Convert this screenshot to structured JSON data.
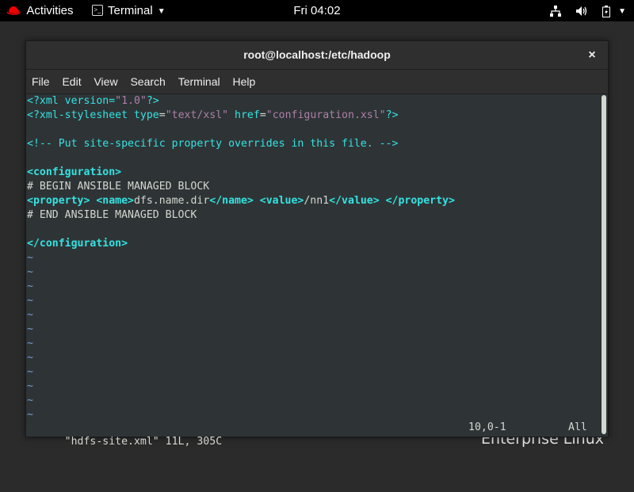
{
  "topbar": {
    "activities": "Activities",
    "app_menu": "Terminal",
    "clock": "Fri 04:02"
  },
  "window": {
    "title": "root@localhost:/etc/hadoop",
    "close": "×",
    "menu": [
      "File",
      "Edit",
      "View",
      "Search",
      "Terminal",
      "Help"
    ]
  },
  "editor": {
    "l1a": "<?xml version=",
    "l1b": "\"1.0\"",
    "l1c": "?>",
    "l2a": "<?xml-stylesheet ",
    "l2b": "type",
    "l2c": "=",
    "l2d": "\"text/xsl\"",
    "l2e": " href",
    "l2f": "=",
    "l2g": "\"configuration.xsl\"",
    "l2h": "?>",
    "l4": "<!-- Put site-specific property overrides in this file. -->",
    "l6": "<configuration>",
    "l7": "# BEGIN ANSIBLE MANAGED BLOCK",
    "l8a": "<property> <name>",
    "l8b": "dfs.name.dir",
    "l8c": "</name> <value>",
    "l8d": "/nn1",
    "l8e": "</value> </property>",
    "l9": "# END ANSIBLE MANAGED BLOCK",
    "l11": "</configuration>",
    "tilde": "~",
    "status_file": "\"hdfs-site.xml\" 11L, 305C",
    "status_pos": "10,0-1",
    "status_pct": "All"
  },
  "desktop": {
    "brand": "Enterprise Linux"
  }
}
